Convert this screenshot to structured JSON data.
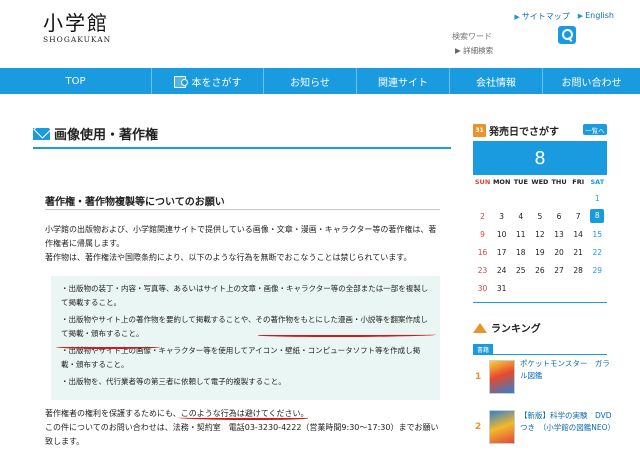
{
  "header": {
    "logo_main": "小学館",
    "logo_sub": "SHOGAKUKAN",
    "util_links": [
      "サイトマップ",
      "English"
    ],
    "search_placeholder": "検索ワード",
    "advanced_search": "詳細検索"
  },
  "nav": {
    "items": [
      "TOP",
      "本をさがす",
      "お知らせ",
      "関連サイト",
      "会社情報",
      "お問い合わせ"
    ]
  },
  "main": {
    "page_title": "画像使用・著作権",
    "section_title": "著作権・著作物複製等についてのお願い",
    "para1": "小学館の出版物および、小学館関連サイトで提供している画像・文章・漫画・キャラクター等の著作権は、著作権者に帰属します。",
    "para2": "著作物は、著作権法や国際条約により、以下のような行為を無断でおこなうことは禁じられています。",
    "list": [
      "・出版物の装丁・内容・写真等、あるいはサイト上の文章・画像・キャラクター等の全部または一部を複製して掲載すること。",
      "・出版物やサイト上の著作物を要約して掲載することや、その著作物をもとにした漫画・小説等を翻案作成して掲載・頒布すること。",
      "・出版物やサイト上の画像・キャラクター等を使用してアイコン・壁紙・コンピュータソフト等を作成し掲載・頒布すること。",
      "・出版物を、代行業者等の第三者に依頼して電子的複製すること。"
    ],
    "para3": "著作権者の権利を保護するためにも、このような行為は避けてください。",
    "para4": "この件についてのお問い合わせは、法務・契約室　電話03-3230-4222（営業時間9:30～17:30）までお願い致します。"
  },
  "sidebar": {
    "calendar_icon_text": "31",
    "calendar_title": "発売日でさがす",
    "list_button": "一覧へ",
    "today": "8",
    "weekdays": [
      "SUN",
      "MON",
      "TUE",
      "WED",
      "THU",
      "FRI",
      "SAT"
    ],
    "weeks": [
      [
        "",
        "",
        "",
        "",
        "",
        "",
        "1"
      ],
      [
        "2",
        "3",
        "4",
        "5",
        "6",
        "7",
        "8"
      ],
      [
        "9",
        "10",
        "11",
        "12",
        "13",
        "14",
        "15"
      ],
      [
        "16",
        "17",
        "18",
        "19",
        "20",
        "21",
        "22"
      ],
      [
        "23",
        "24",
        "25",
        "26",
        "27",
        "28",
        "29"
      ],
      [
        "30",
        "31",
        "",
        "",
        "",
        "",
        ""
      ]
    ],
    "ranking_title": "ランキング",
    "ranking_badge": "書籍",
    "ranking": [
      {
        "rank": "1",
        "title": "ポケットモンスター　ガラル図鑑"
      },
      {
        "rank": "2",
        "title": "【新版】科学の実験　DVDつき　（小学館の図鑑NEO）"
      }
    ]
  },
  "colors": {
    "accent": "#1a9be0",
    "title_underline": "#1a9be0",
    "list_background": "#eaf6f3",
    "annotation_red": "#d21a1a",
    "sunday": "#d2453a",
    "saturday": "#1a9be0",
    "ranking_orange": "#e8942a"
  }
}
